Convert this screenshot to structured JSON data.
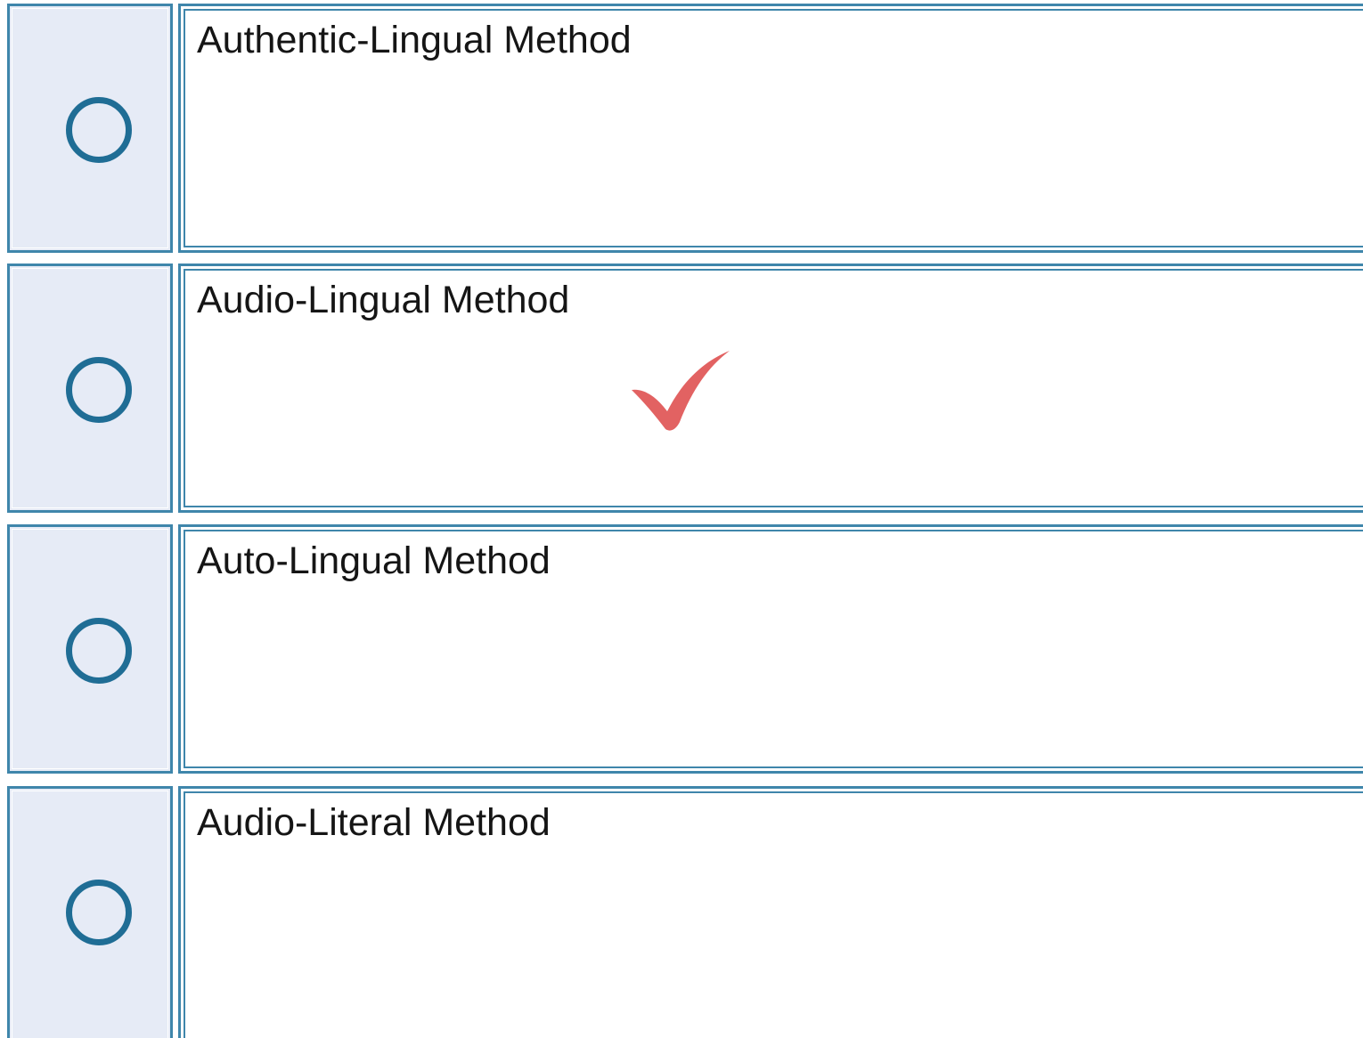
{
  "question": {
    "options": [
      {
        "label": "Authentic-Lingual Method",
        "correct": false
      },
      {
        "label": "Audio-Lingual Method",
        "correct": true
      },
      {
        "label": "Auto-Lingual Method",
        "correct": false
      },
      {
        "label": "Audio-Literal Method",
        "correct": false
      }
    ],
    "correct_marker_icon": "checkmark-icon",
    "colors": {
      "border": "#3f86ab",
      "radio_ring": "#1f6d95",
      "radio_cell_bg": "#e6ebf6",
      "checkmark": "#e05555"
    }
  }
}
